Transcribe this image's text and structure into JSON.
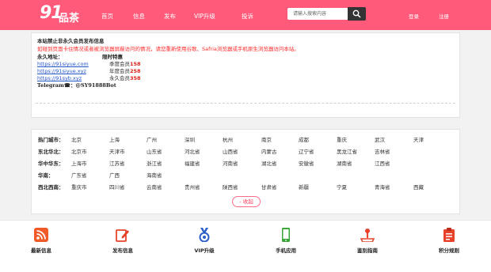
{
  "header": {
    "logo_num": "91",
    "logo_text": "品茶",
    "nav": [
      "首页",
      "信息",
      "发布",
      "VIP升级",
      "投诉"
    ],
    "search_placeholder": "请输入搜索内容",
    "login": "登录",
    "register": "注册"
  },
  "notice": {
    "title": "本站禁止非永久会员发布信息",
    "warning": "如碰到页面卡住情况或者被浏览器屏蔽访问的情况，请您重新使用谷歌、Safria浏览器或手机原生浏览器访问本站。",
    "addr_title": "永久地址：",
    "links": [
      "https://91siyue.com",
      "https://91siyue.xyz",
      "https://91syb.xyz"
    ],
    "special_title": "限时特惠",
    "prices": [
      {
        "label": "季度会员",
        "value": "158"
      },
      {
        "label": "年度会员",
        "value": "258"
      },
      {
        "label": "永久会员",
        "value": "358"
      }
    ],
    "telegram": "Telegram☎：@SY91888Bot"
  },
  "regions": [
    {
      "label": "热门城市：",
      "cities": [
        "北京",
        "上海",
        "广州",
        "深圳",
        "杭州",
        "南京",
        "成都",
        "重庆",
        "武汉",
        "天津"
      ]
    },
    {
      "label": "东北华北：",
      "cities": [
        "北京市",
        "天津市",
        "山东省",
        "河北省",
        "山西省",
        "内蒙古",
        "辽宁省",
        "黑龙江省",
        "吉林省"
      ]
    },
    {
      "label": "华中华东：",
      "cities": [
        "上海市",
        "江苏省",
        "浙江省",
        "福建省",
        "河南省",
        "湖北省",
        "安徽省",
        "湖南省",
        "江西省"
      ]
    },
    {
      "label": "华南：",
      "cities": [
        "广东省",
        "广西",
        "海南省"
      ]
    },
    {
      "label": "西北西南：",
      "cities": [
        "重庆市",
        "四川省",
        "云南省",
        "贵州省",
        "陕西省",
        "甘肃省",
        "新疆",
        "宁夏",
        "青海省",
        "西藏"
      ]
    }
  ],
  "collapse_label": "- 收起",
  "footer": [
    {
      "label": "最新信息",
      "icon": "rss-icon",
      "color": "#f05a28"
    },
    {
      "label": "发布信息",
      "icon": "edit-icon",
      "color": "#e8432a"
    },
    {
      "label": "VIP升级",
      "icon": "medal-icon",
      "color": "#2b5fc9"
    },
    {
      "label": "手机应用",
      "icon": "phone-icon",
      "color": "#3aa63a"
    },
    {
      "label": "鉴别指南",
      "icon": "pin-icon",
      "color": "#e8432a"
    },
    {
      "label": "积分规则",
      "icon": "clipboard-icon",
      "color": "#e8432a"
    }
  ]
}
